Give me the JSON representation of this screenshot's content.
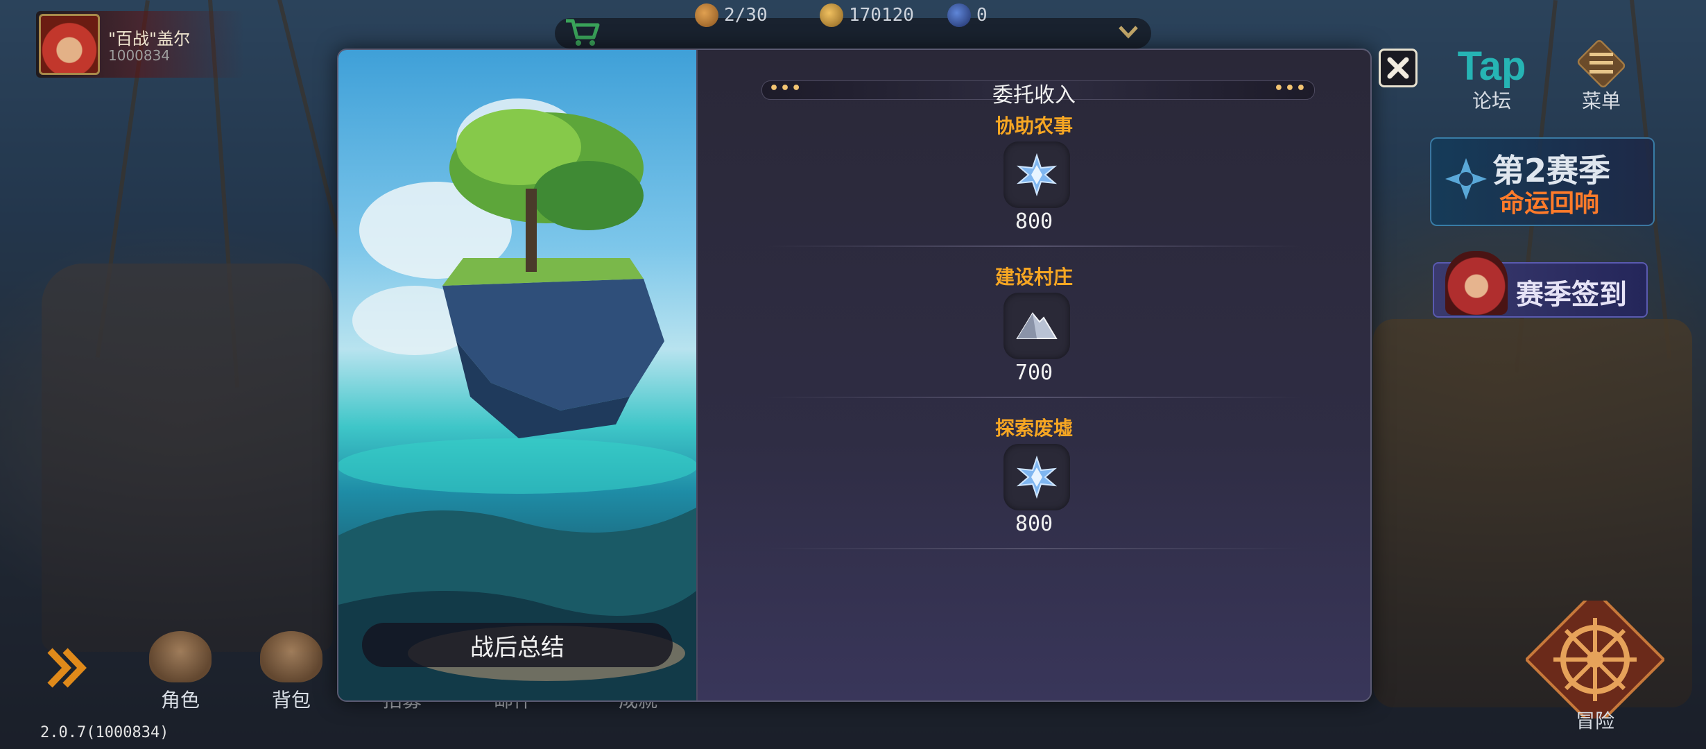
{
  "player": {
    "name": "\"百战\"盖尔",
    "id": "1000834"
  },
  "resources": [
    {
      "icon": "bread-icon",
      "value": "2/30",
      "color": "#b8762e"
    },
    {
      "icon": "gold-coin-icon",
      "value": "170120",
      "color": "#c7953a"
    },
    {
      "icon": "blue-gem-icon",
      "value": "0",
      "color": "#2d4f9a"
    }
  ],
  "top_right": {
    "forum_logo": "Tap",
    "forum_label": "论坛",
    "menu_label": "菜单"
  },
  "season": {
    "line1": "第2赛季",
    "line2": "命运回响",
    "signin": "赛季签到"
  },
  "bottom_nav": [
    "角色",
    "背包",
    "招募",
    "邮件",
    "成就"
  ],
  "adventure_label": "冒险",
  "version": "2.0.7(1000834)",
  "modal": {
    "title": "委托收入",
    "summary_button": "战后总结",
    "entries": [
      {
        "name": "协助农事",
        "reward_icon": "blue-crystal-icon",
        "amount": "800"
      },
      {
        "name": "建设村庄",
        "reward_icon": "silver-ore-icon",
        "amount": "700"
      },
      {
        "name": "探索废墟",
        "reward_icon": "blue-crystal-icon",
        "amount": "800"
      }
    ]
  },
  "colors": {
    "entry_name": "#f6a623",
    "accent_gold": "#f3c572",
    "panel_bg": "#2f2d44"
  }
}
